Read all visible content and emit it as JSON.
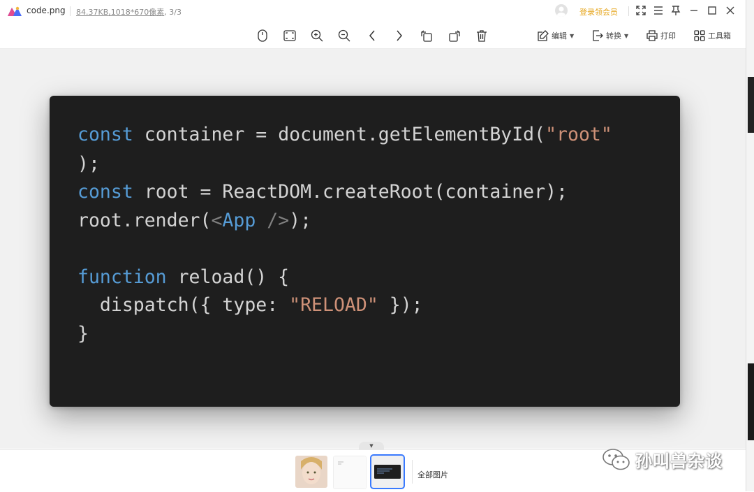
{
  "window": {
    "file_name": "code.png",
    "file_size": "84.37KB",
    "dimensions": ",1018*670像素",
    "page_index": ", 3/3",
    "vip_label": "登录领会员",
    "icons": [
      "fullscreen-icon",
      "menu-icon",
      "pin-icon",
      "minimize-icon",
      "maximize-icon",
      "close-icon"
    ]
  },
  "toolbar": {
    "edit_label": "编辑",
    "convert_label": "转换",
    "print_label": "打印",
    "toolbox_label": "工具箱",
    "icons": [
      "mouse-icon",
      "fit-screen-icon",
      "zoom-in-icon",
      "zoom-out-icon",
      "previous-icon",
      "next-icon",
      "rotate-left-icon",
      "rotate-right-icon",
      "delete-icon"
    ]
  },
  "code": {
    "lines": [
      [
        {
          "t": "const",
          "c": "kw"
        },
        {
          "t": " container = document.getElementById(",
          "c": ""
        },
        {
          "t": "\"root\"",
          "c": "str"
        }
      ],
      [
        {
          "t": ");",
          "c": ""
        }
      ],
      [
        {
          "t": "const",
          "c": "kw"
        },
        {
          "t": " root = ReactDOM.createRoot(container);",
          "c": ""
        }
      ],
      [
        {
          "t": "root.render(",
          "c": ""
        },
        {
          "t": "<",
          "c": "tag"
        },
        {
          "t": "App",
          "c": "kw"
        },
        {
          "t": " />",
          "c": "tag"
        },
        {
          "t": ");",
          "c": ""
        }
      ],
      [],
      [
        {
          "t": "function",
          "c": "kw"
        },
        {
          "t": " reload() {",
          "c": ""
        }
      ],
      [
        {
          "t": "  dispatch({ type: ",
          "c": ""
        },
        {
          "t": "\"RELOAD\"",
          "c": "str"
        },
        {
          "t": " });",
          "c": ""
        }
      ],
      [
        {
          "t": "}",
          "c": ""
        }
      ]
    ],
    "colors": {
      "background": "#1e1e1e",
      "text": "#d4d4d4",
      "keyword": "#569cd6",
      "string": "#ce9178",
      "tag": "#808080"
    }
  },
  "filmstrip": {
    "all_images_label": "全部图片",
    "active_index": 2
  },
  "watermark": {
    "text": "孙叫兽杂谈"
  }
}
